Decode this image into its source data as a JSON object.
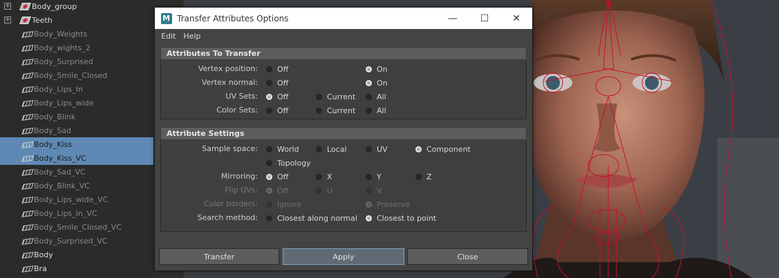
{
  "outliner": {
    "items": [
      {
        "label": "Body_group",
        "kind": "group",
        "expandable": true,
        "style": "top"
      },
      {
        "label": "Teeth",
        "kind": "group",
        "expandable": true,
        "style": "top"
      },
      {
        "label": "Body_Weights",
        "kind": "blend",
        "style": "dim"
      },
      {
        "label": "Body_wights_2",
        "kind": "blend",
        "style": "dim"
      },
      {
        "label": "Body_Surprised",
        "kind": "blend",
        "style": "dim"
      },
      {
        "label": "Body_Smile_Closed",
        "kind": "blend",
        "style": "dim"
      },
      {
        "label": "Body_Lips_In",
        "kind": "blend",
        "style": "dim"
      },
      {
        "label": "Body_Lips_wide",
        "kind": "blend",
        "style": "dim"
      },
      {
        "label": "Body_Blink",
        "kind": "blend",
        "style": "dim"
      },
      {
        "label": "Body_Sad",
        "kind": "blend",
        "style": "dim"
      },
      {
        "label": "Body_Kiss",
        "kind": "blend",
        "style": "selected"
      },
      {
        "label": "Body_Kiss_VC",
        "kind": "blend",
        "style": "selected"
      },
      {
        "label": "Body_Sad_VC",
        "kind": "blend",
        "style": "dim"
      },
      {
        "label": "Body_Blink_VC",
        "kind": "blend",
        "style": "dim"
      },
      {
        "label": "Body_Lips_wide_VC",
        "kind": "blend",
        "style": "dim"
      },
      {
        "label": "Body_Lips_In_VC",
        "kind": "blend",
        "style": "dim"
      },
      {
        "label": "Body_Smile_Closed_VC",
        "kind": "blend",
        "style": "dim"
      },
      {
        "label": "Body_Surprised_VC",
        "kind": "blend",
        "style": "dim"
      },
      {
        "label": "Body",
        "kind": "blend",
        "style": "top"
      },
      {
        "label": "Bra",
        "kind": "blend",
        "style": "top"
      }
    ],
    "selection_color": "#5f89b4",
    "expand_glyph": "+"
  },
  "dialog": {
    "title": "Transfer Attributes Options",
    "icon": "maya-app-icon",
    "window_buttons": {
      "minimize": "—",
      "maximize": "☐",
      "close": "✕"
    },
    "menus": [
      "Edit",
      "Help"
    ],
    "sections": [
      {
        "title": "Attributes To Transfer",
        "rows": [
          {
            "label": "Vertex position:",
            "enabled": true,
            "options": [
              {
                "label": "Off",
                "selected": false
              },
              {
                "label": "On",
                "selected": true
              }
            ],
            "cols": [
              0,
              2
            ]
          },
          {
            "label": "Vertex normal:",
            "enabled": true,
            "options": [
              {
                "label": "Off",
                "selected": false
              },
              {
                "label": "On",
                "selected": true
              }
            ],
            "cols": [
              0,
              2
            ]
          },
          {
            "label": "UV Sets:",
            "enabled": true,
            "options": [
              {
                "label": "Off",
                "selected": true
              },
              {
                "label": "Current",
                "selected": false
              },
              {
                "label": "All",
                "selected": false
              }
            ],
            "cols": [
              0,
              1,
              2
            ]
          },
          {
            "label": "Color Sets:",
            "enabled": true,
            "options": [
              {
                "label": "Off",
                "selected": false
              },
              {
                "label": "Current",
                "selected": false
              },
              {
                "label": "All",
                "selected": false
              }
            ],
            "cols": [
              0,
              1,
              2
            ]
          }
        ]
      },
      {
        "title": "Attribute Settings",
        "rows": [
          {
            "label": "Sample space:",
            "enabled": true,
            "options": [
              {
                "label": "World",
                "selected": false
              },
              {
                "label": "Local",
                "selected": false
              },
              {
                "label": "UV",
                "selected": false
              },
              {
                "label": "Component",
                "selected": true
              }
            ],
            "cols": [
              0,
              1,
              2,
              3
            ]
          },
          {
            "label": "",
            "enabled": true,
            "options": [
              {
                "label": "Topology",
                "selected": false
              }
            ],
            "cols": [
              0
            ]
          },
          {
            "label": "Mirroring:",
            "enabled": true,
            "options": [
              {
                "label": "Off",
                "selected": true
              },
              {
                "label": "X",
                "selected": false
              },
              {
                "label": "Y",
                "selected": false
              },
              {
                "label": "Z",
                "selected": false
              }
            ],
            "cols": [
              0,
              1,
              2,
              3
            ]
          },
          {
            "label": "Flip UVs:",
            "enabled": false,
            "options": [
              {
                "label": "Off",
                "selected": true
              },
              {
                "label": "U",
                "selected": false
              },
              {
                "label": "V",
                "selected": false
              }
            ],
            "cols": [
              0,
              1,
              2
            ]
          },
          {
            "label": "Color borders:",
            "enabled": false,
            "options": [
              {
                "label": "Ignore",
                "selected": false
              },
              {
                "label": "Preserve",
                "selected": true
              }
            ],
            "cols": [
              0,
              2
            ]
          },
          {
            "label": "Search method:",
            "enabled": true,
            "options": [
              {
                "label": "Closest along normal",
                "selected": false
              },
              {
                "label": "Closest to point",
                "selected": true
              }
            ],
            "cols": [
              0,
              2
            ]
          }
        ]
      }
    ],
    "buttons": [
      {
        "label": "Transfer",
        "focused": false
      },
      {
        "label": "Apply",
        "focused": true
      },
      {
        "label": "Close",
        "focused": false
      }
    ]
  },
  "viewport": {
    "rig_color": "#c8102e",
    "background_color": "#3c4046"
  }
}
